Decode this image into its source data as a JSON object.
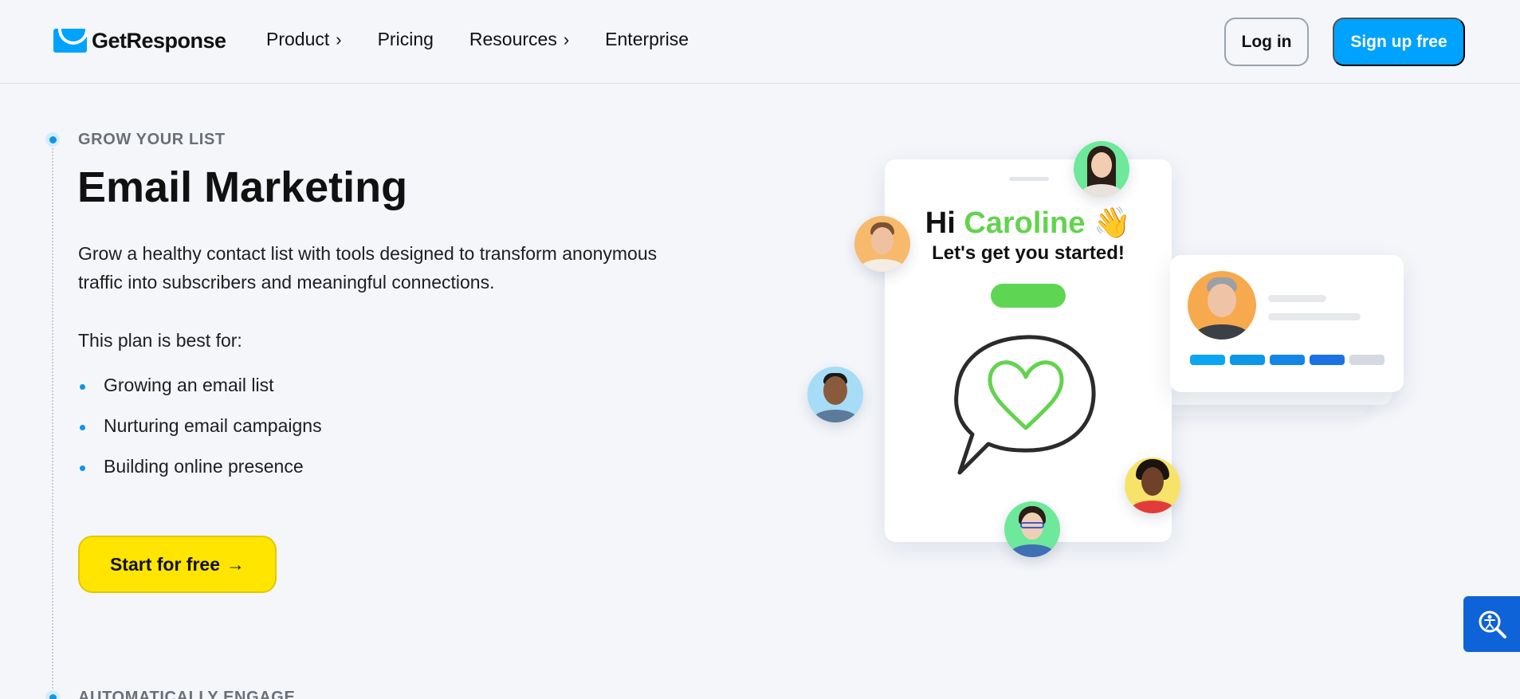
{
  "header": {
    "logo_text": "GetResponse",
    "nav": [
      {
        "label": "Product",
        "chevron": "›"
      },
      {
        "label": "Pricing",
        "chevron": ""
      },
      {
        "label": "Resources",
        "chevron": "›"
      },
      {
        "label": "Enterprise",
        "chevron": ""
      }
    ],
    "login_label": "Log in",
    "signup_label": "Sign up free"
  },
  "hero": {
    "eyebrow": "GROW YOUR LIST",
    "title": "Email Marketing",
    "description": "Grow a healthy contact list with tools designed to transform anonymous traffic into subscribers and meaningful connections.",
    "plan_label": "This plan is best for:",
    "bullets": [
      "Growing an email list",
      "Nurturing email campaigns",
      "Building online presence"
    ],
    "cta_label": "Start for free",
    "cta_arrow": "→",
    "next_eyebrow": "AUTOMATICALLY ENGAGE"
  },
  "illustration": {
    "greeting": "Hi",
    "name": "Caroline",
    "wave": "👋",
    "subtitle": "Let's get you started!",
    "accent_green": "#63d34e",
    "progress_colors": [
      "#0aa6f2",
      "#0c97e8",
      "#1486e6",
      "#1a72e3",
      "#d5dae1"
    ]
  },
  "colors": {
    "brand_blue": "#00a2ff",
    "cta_yellow": "#ffe500",
    "accessibility_blue": "#0e63d8"
  },
  "icons": {
    "logo": "envelope-icon",
    "accessibility": "accessibility-search-icon"
  }
}
